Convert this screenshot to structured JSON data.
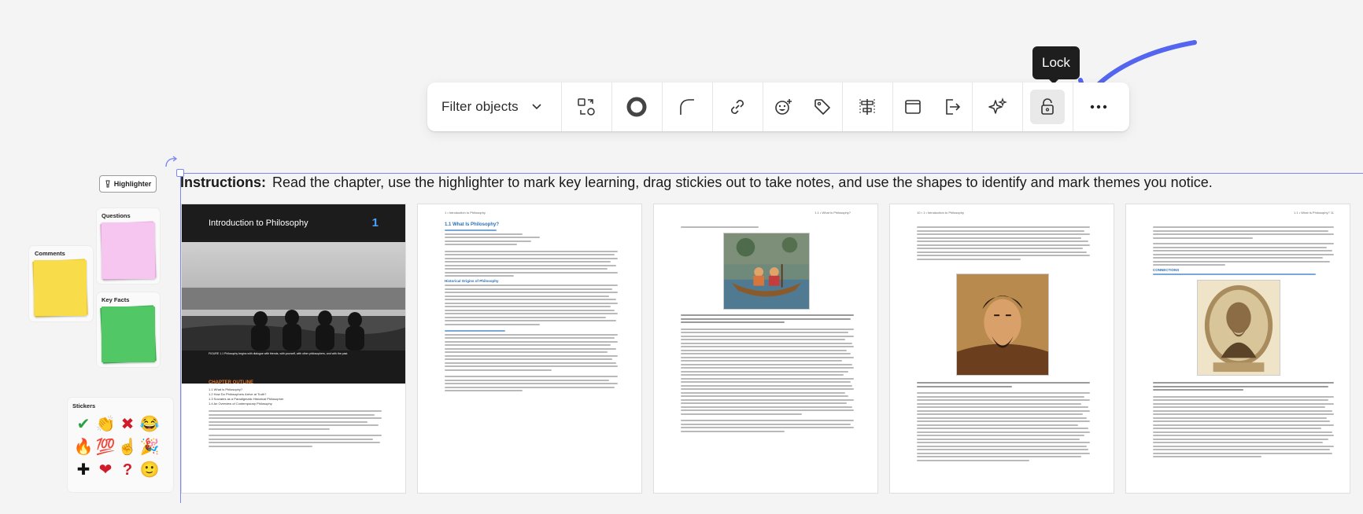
{
  "toolbar": {
    "filter_label": "Filter objects",
    "buttons": [
      "replace-object-icon",
      "ring-shape-icon",
      "corner-radius-icon",
      "link-icon",
      "emoji-add-icon",
      "tag-icon",
      "align-distribute-icon",
      "frame-icon",
      "export-icon",
      "ai-sparkle-icon",
      "lock-icon",
      "more-options-icon"
    ],
    "tooltip": "Lock"
  },
  "colors": {
    "accent": "#7c86f5",
    "annotation": "#5465f0",
    "comments": "#f8dc4a",
    "questions": "#f6c6f0",
    "key_facts": "#52c766"
  },
  "left_panels": {
    "highlighter_label": "Highlighter",
    "comments_title": "Comments",
    "questions_title": "Questions",
    "key_facts_title": "Key Facts",
    "stickers_title": "Stickers",
    "stickers": [
      "✔",
      "👏",
      "✖",
      "😂",
      "🔥",
      "💯",
      "☝",
      "🎉",
      "✚",
      "❤",
      "?",
      "🙂"
    ]
  },
  "instructions": {
    "label": "Instructions:",
    "text": "Read the chapter, use the highlighter to mark key learning, drag stickies out to take notes, and use the shapes to identify and mark themes you notice."
  },
  "pages": {
    "p1": {
      "title": "Introduction to Philosophy",
      "chapter_num": "1",
      "caption": "FIGURE 1.1 Philosophy begins with dialogue with friends, with yourself, with other philosophers, and with the past.",
      "outline_title": "CHAPTER OUTLINE",
      "outline": [
        "1.1 What Is Philosophy?",
        "1.2 How Do Philosophers Arrive at Truth?",
        "1.3 Socrates as a Paradigmatic Historical Philosopher",
        "1.4 An Overview of Contemporary Philosophy"
      ]
    },
    "p2": {
      "header": "1 • Introduction to Philosophy",
      "section_title": "1.1 What Is Philosophy?",
      "subsection": "Historical Origins of Philosophy"
    },
    "p3": {
      "header": "1.1 • What Is Philosophy?"
    },
    "p4": {
      "header": "10 • 1 • Introduction to Philosophy"
    },
    "p5": {
      "header": "1.1 • What Is Philosophy? 11",
      "connections": "CONNECTIONS"
    }
  }
}
